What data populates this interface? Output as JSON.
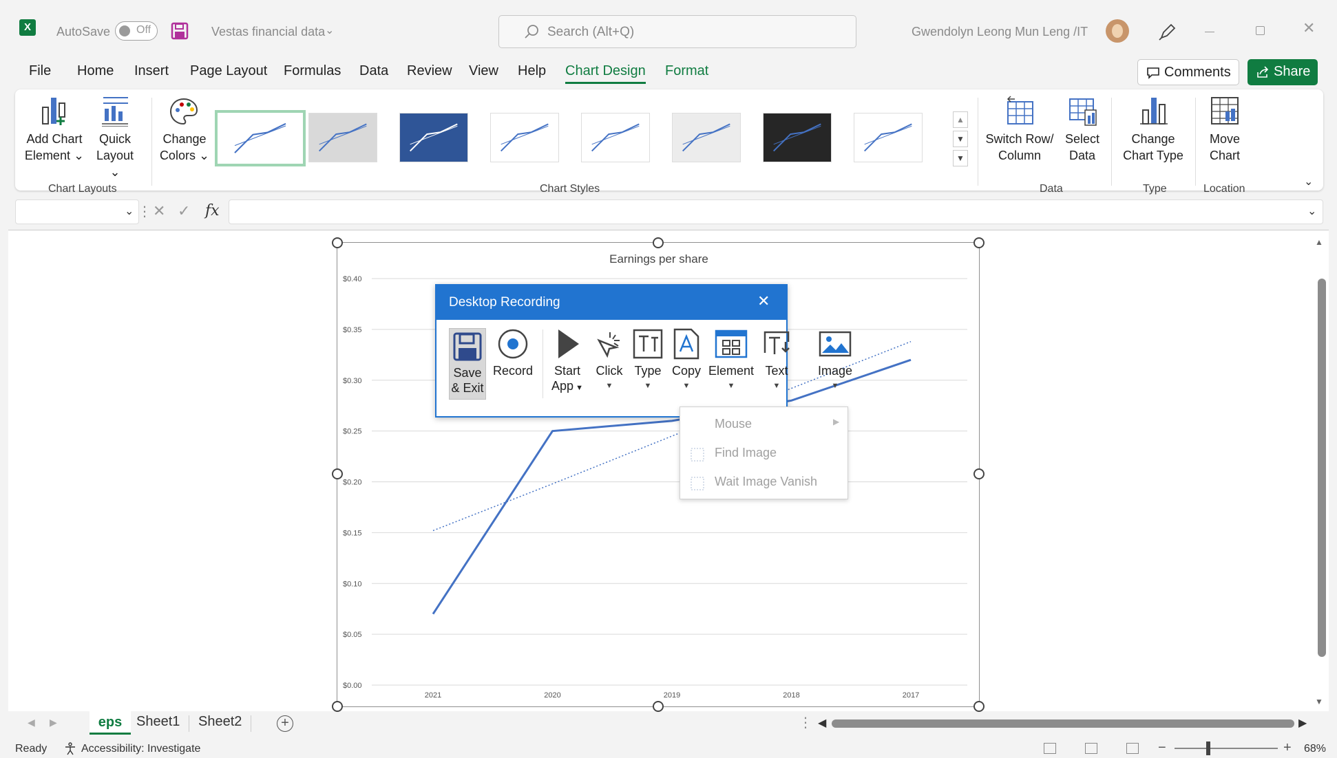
{
  "titlebar": {
    "autosave_label": "AutoSave",
    "autosave_state": "Off",
    "file_name": "Vestas financial data",
    "search_placeholder": "Search (Alt+Q)",
    "user_name": "Gwendolyn Leong Mun Leng /IT"
  },
  "menu": {
    "items": [
      "File",
      "Home",
      "Insert",
      "Page Layout",
      "Formulas",
      "Data",
      "Review",
      "View",
      "Help",
      "Chart Design",
      "Format"
    ],
    "active": "Chart Design",
    "comments_label": "Comments",
    "share_label": "Share"
  },
  "ribbon": {
    "add_chart_element": [
      "Add Chart",
      "Element"
    ],
    "quick_layout": [
      "Quick",
      "Layout"
    ],
    "change_colors": [
      "Change",
      "Colors"
    ],
    "switch_row_column": [
      "Switch Row/",
      "Column"
    ],
    "select_data": [
      "Select",
      "Data"
    ],
    "change_chart_type": [
      "Change",
      "Chart Type"
    ],
    "move_chart": [
      "Move",
      "Chart"
    ],
    "group_labels": {
      "chart_layouts": "Chart Layouts",
      "chart_styles": "Chart Styles",
      "data": "Data",
      "type": "Type",
      "location": "Location"
    }
  },
  "formula_bar": {
    "fx_label": "fx"
  },
  "chart_data": {
    "type": "line",
    "title": "Earnings per share",
    "categories": [
      "2021",
      "2020",
      "2019",
      "2018",
      "2017"
    ],
    "series": [
      {
        "values": [
          0.07,
          0.25,
          0.26,
          0.28,
          0.32
        ]
      }
    ],
    "trendline": {
      "values": [
        0.152,
        0.198,
        0.245,
        0.292,
        0.338
      ],
      "style": "dotted"
    },
    "ylim": [
      0,
      0.4
    ],
    "yticks": [
      "$0.00",
      "$0.05",
      "$0.10",
      "$0.15",
      "$0.20",
      "$0.25",
      "$0.30",
      "$0.35",
      "$0.40"
    ],
    "grid": true,
    "line_color": "#4472c4"
  },
  "dialog": {
    "title": "Desktop Recording",
    "buttons": {
      "save": [
        "Save",
        "& Exit"
      ],
      "record": "Record",
      "start_app": [
        "Start",
        "App"
      ],
      "click": "Click",
      "type": "Type",
      "copy": "Copy",
      "element": "Element",
      "text": "Text",
      "image": "Image"
    },
    "popup_items": [
      "Mouse",
      "Find Image",
      "Wait Image Vanish"
    ]
  },
  "sheet_tabs": [
    "eps",
    "Sheet1",
    "Sheet2"
  ],
  "active_tab": "eps",
  "status": {
    "ready": "Ready",
    "accessibility": "Accessibility: Investigate",
    "zoom": "68%"
  },
  "colors": {
    "excel_green": "#107c41",
    "dialog_blue": "#2174d0"
  }
}
